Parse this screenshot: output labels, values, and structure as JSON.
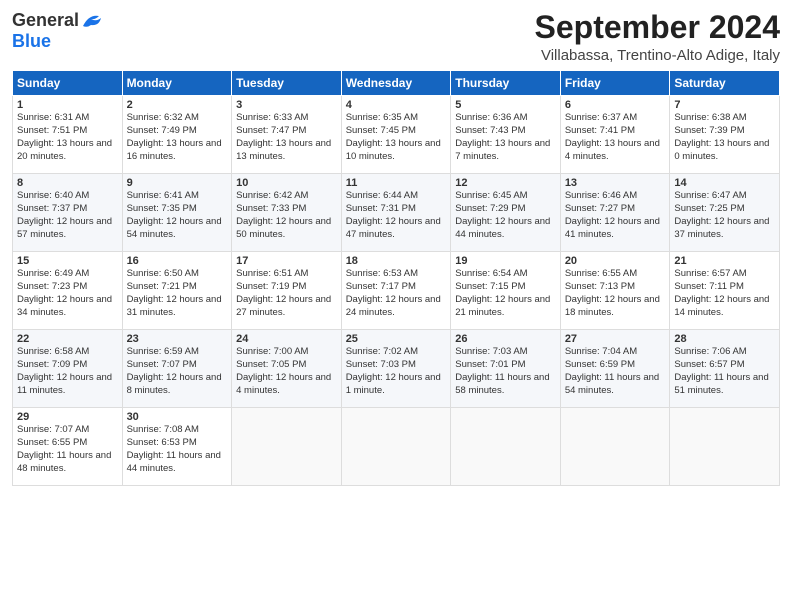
{
  "header": {
    "logo_general": "General",
    "logo_blue": "Blue",
    "month": "September 2024",
    "location": "Villabassa, Trentino-Alto Adige, Italy"
  },
  "days": [
    "Sunday",
    "Monday",
    "Tuesday",
    "Wednesday",
    "Thursday",
    "Friday",
    "Saturday"
  ],
  "weeks": [
    [
      {
        "num": "1",
        "sunrise": "6:31 AM",
        "sunset": "7:51 PM",
        "daylight": "13 hours and 20 minutes."
      },
      {
        "num": "2",
        "sunrise": "6:32 AM",
        "sunset": "7:49 PM",
        "daylight": "13 hours and 16 minutes."
      },
      {
        "num": "3",
        "sunrise": "6:33 AM",
        "sunset": "7:47 PM",
        "daylight": "13 hours and 13 minutes."
      },
      {
        "num": "4",
        "sunrise": "6:35 AM",
        "sunset": "7:45 PM",
        "daylight": "13 hours and 10 minutes."
      },
      {
        "num": "5",
        "sunrise": "6:36 AM",
        "sunset": "7:43 PM",
        "daylight": "13 hours and 7 minutes."
      },
      {
        "num": "6",
        "sunrise": "6:37 AM",
        "sunset": "7:41 PM",
        "daylight": "13 hours and 4 minutes."
      },
      {
        "num": "7",
        "sunrise": "6:38 AM",
        "sunset": "7:39 PM",
        "daylight": "13 hours and 0 minutes."
      }
    ],
    [
      {
        "num": "8",
        "sunrise": "6:40 AM",
        "sunset": "7:37 PM",
        "daylight": "12 hours and 57 minutes."
      },
      {
        "num": "9",
        "sunrise": "6:41 AM",
        "sunset": "7:35 PM",
        "daylight": "12 hours and 54 minutes."
      },
      {
        "num": "10",
        "sunrise": "6:42 AM",
        "sunset": "7:33 PM",
        "daylight": "12 hours and 50 minutes."
      },
      {
        "num": "11",
        "sunrise": "6:44 AM",
        "sunset": "7:31 PM",
        "daylight": "12 hours and 47 minutes."
      },
      {
        "num": "12",
        "sunrise": "6:45 AM",
        "sunset": "7:29 PM",
        "daylight": "12 hours and 44 minutes."
      },
      {
        "num": "13",
        "sunrise": "6:46 AM",
        "sunset": "7:27 PM",
        "daylight": "12 hours and 41 minutes."
      },
      {
        "num": "14",
        "sunrise": "6:47 AM",
        "sunset": "7:25 PM",
        "daylight": "12 hours and 37 minutes."
      }
    ],
    [
      {
        "num": "15",
        "sunrise": "6:49 AM",
        "sunset": "7:23 PM",
        "daylight": "12 hours and 34 minutes."
      },
      {
        "num": "16",
        "sunrise": "6:50 AM",
        "sunset": "7:21 PM",
        "daylight": "12 hours and 31 minutes."
      },
      {
        "num": "17",
        "sunrise": "6:51 AM",
        "sunset": "7:19 PM",
        "daylight": "12 hours and 27 minutes."
      },
      {
        "num": "18",
        "sunrise": "6:53 AM",
        "sunset": "7:17 PM",
        "daylight": "12 hours and 24 minutes."
      },
      {
        "num": "19",
        "sunrise": "6:54 AM",
        "sunset": "7:15 PM",
        "daylight": "12 hours and 21 minutes."
      },
      {
        "num": "20",
        "sunrise": "6:55 AM",
        "sunset": "7:13 PM",
        "daylight": "12 hours and 18 minutes."
      },
      {
        "num": "21",
        "sunrise": "6:57 AM",
        "sunset": "7:11 PM",
        "daylight": "12 hours and 14 minutes."
      }
    ],
    [
      {
        "num": "22",
        "sunrise": "6:58 AM",
        "sunset": "7:09 PM",
        "daylight": "12 hours and 11 minutes."
      },
      {
        "num": "23",
        "sunrise": "6:59 AM",
        "sunset": "7:07 PM",
        "daylight": "12 hours and 8 minutes."
      },
      {
        "num": "24",
        "sunrise": "7:00 AM",
        "sunset": "7:05 PM",
        "daylight": "12 hours and 4 minutes."
      },
      {
        "num": "25",
        "sunrise": "7:02 AM",
        "sunset": "7:03 PM",
        "daylight": "12 hours and 1 minute."
      },
      {
        "num": "26",
        "sunrise": "7:03 AM",
        "sunset": "7:01 PM",
        "daylight": "11 hours and 58 minutes."
      },
      {
        "num": "27",
        "sunrise": "7:04 AM",
        "sunset": "6:59 PM",
        "daylight": "11 hours and 54 minutes."
      },
      {
        "num": "28",
        "sunrise": "7:06 AM",
        "sunset": "6:57 PM",
        "daylight": "11 hours and 51 minutes."
      }
    ],
    [
      {
        "num": "29",
        "sunrise": "7:07 AM",
        "sunset": "6:55 PM",
        "daylight": "11 hours and 48 minutes."
      },
      {
        "num": "30",
        "sunrise": "7:08 AM",
        "sunset": "6:53 PM",
        "daylight": "11 hours and 44 minutes."
      },
      null,
      null,
      null,
      null,
      null
    ]
  ]
}
